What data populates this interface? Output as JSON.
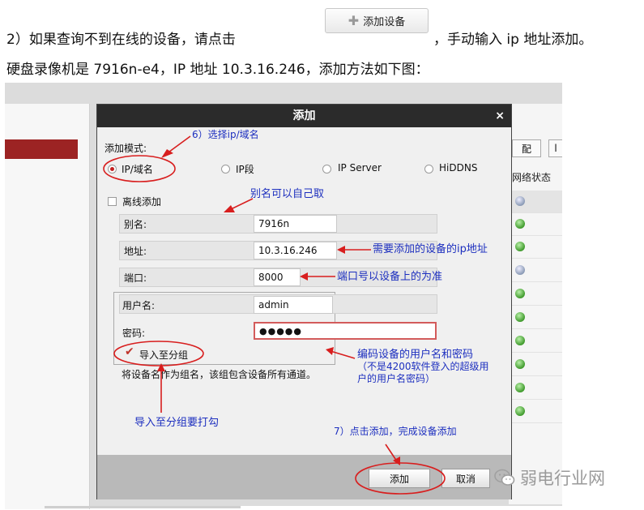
{
  "doc": {
    "line1_a": "2）如果查询不到在线的设备，请点击",
    "line1_b": "，手动输入 ip 地址添加。",
    "line2": "硬盘录像机是 7916n-e4，IP 地址 10.3.16.246，添加方法如下图：",
    "add_device_button": "添加设备",
    "plus_icon": "✚"
  },
  "background": {
    "right_btn1": "配",
    "right_btn2": "l",
    "status_header": "网络状态"
  },
  "dialog": {
    "title": "添加",
    "close": "×",
    "mode_label": "添加模式:",
    "modes": [
      "IP/域名",
      "IP段",
      "IP Server",
      "HiDDNS"
    ],
    "offline_label": "离线添加",
    "alias_label": "别名:",
    "alias_value": "7916n",
    "address_label": "地址:",
    "address_value": "10.3.16.246",
    "port_label": "端口:",
    "port_value": "8000",
    "username_label": "用户名:",
    "username_value": "admin",
    "password_label": "密码:",
    "password_value": "●●●●●",
    "import_label": "导入至分组",
    "import_note": "将设备名作为组名，该组包含设备所有通道。",
    "add_button": "添加",
    "cancel_button": "取消"
  },
  "annotations": {
    "select_ip": "6）选择ip/域名",
    "alias_note": "别名可以自己取",
    "address_note": "需要添加的设备的ip地址",
    "port_note": "端口号以设备上的为准",
    "cred_note_1": "编码设备的用户名和密码",
    "cred_note_2": "（不是4200软件登入的超级用",
    "cred_note_3": "户的用户名密码）",
    "import_note": "导入至分组要打勾",
    "finish_note": "7）点击添加，完成设备添加"
  },
  "watermark": "弱电行业网",
  "colors": {
    "annotation_blue": "#1d2fbf",
    "annotation_red": "#d81e1e",
    "title_bar": "#2b2b2b",
    "selection_red": "#9c2323"
  }
}
